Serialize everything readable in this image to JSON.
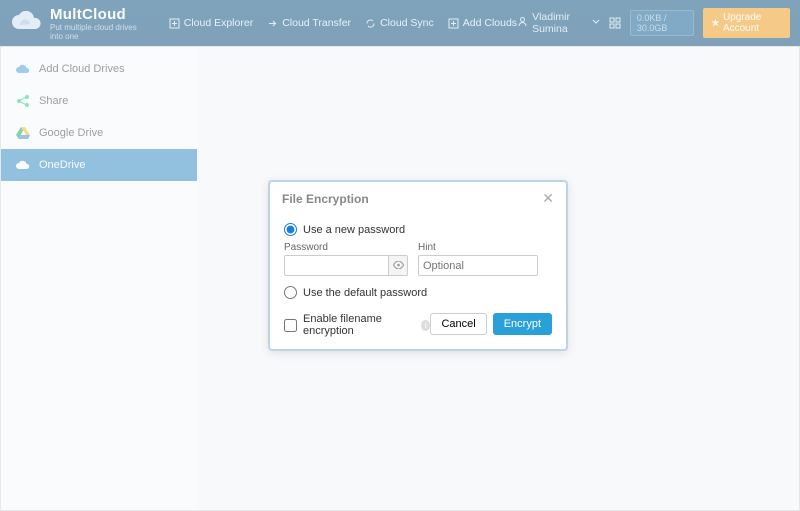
{
  "header": {
    "brand": "MultCloud",
    "tagline": "Put multiple cloud drives into one",
    "nav": {
      "explorer": "Cloud Explorer",
      "transfer": "Cloud Transfer",
      "sync": "Cloud Sync",
      "add": "Add Clouds"
    },
    "user": "Vladimir Sumina",
    "storage": "0.0KB / 30.0GB",
    "upgrade": "Upgrade Account"
  },
  "sidebar": {
    "items": [
      {
        "label": "Add Cloud Drives"
      },
      {
        "label": "Share"
      },
      {
        "label": "Google Drive"
      },
      {
        "label": "OneDrive"
      }
    ]
  },
  "modal": {
    "title": "File Encryption",
    "opt_new": "Use a new password",
    "password_label": "Password",
    "hint_label": "Hint",
    "hint_placeholder": "Optional",
    "opt_default": "Use the default password",
    "enable_filename": "Enable filename encryption",
    "cancel": "Cancel",
    "encrypt": "Encrypt"
  }
}
